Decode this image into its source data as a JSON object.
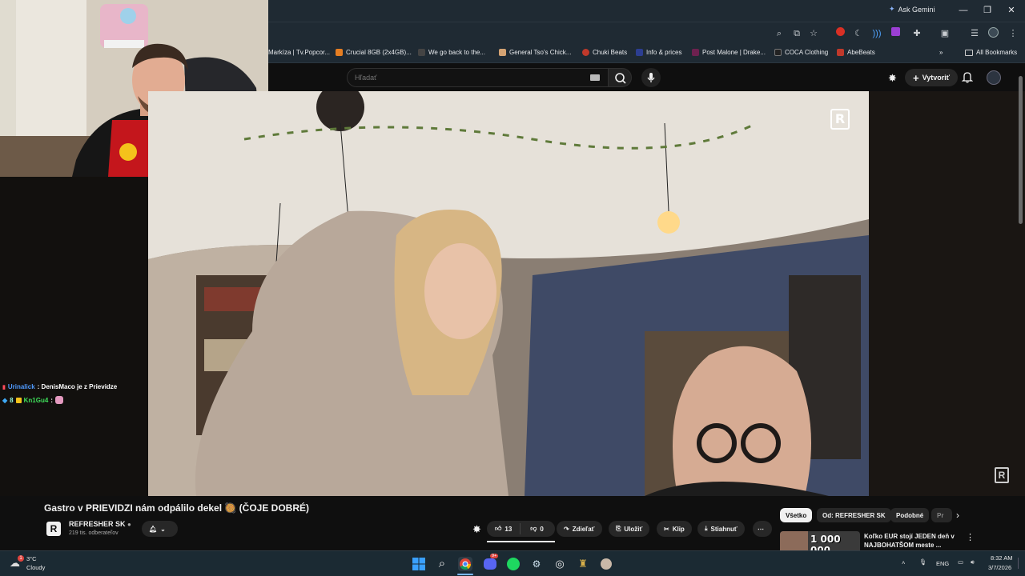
{
  "browser": {
    "ask_gemini": "Ask Gemini",
    "window_controls": {
      "minimize": "—",
      "restore": "❐",
      "close": "✕"
    },
    "bookmarks": [
      {
        "label": "Markíza | Tv.Popcor...",
        "color": "#c0392b"
      },
      {
        "label": "Crucial 8GB (2x4GB)...",
        "color": "#e67e22"
      },
      {
        "label": "We go back to the...",
        "color": "#444444"
      },
      {
        "label": "General Tso's Chick...",
        "color": "#d4a373"
      },
      {
        "label": "Chuki Beats",
        "color": "#c0392b"
      },
      {
        "label": "Info & prices",
        "color": "#2c3e91"
      },
      {
        "label": "Post Malone | Drake...",
        "color": "#6d214f"
      },
      {
        "label": "COCA Clothing",
        "color": "#222222"
      },
      {
        "label": "AbeBeats",
        "color": "#c0392b"
      }
    ],
    "all_bookmarks": "All Bookmarks"
  },
  "youtube": {
    "search_placeholder": "Hľadať",
    "create_label": "Vytvoriť",
    "video_title": "Gastro v PRIEVIDZI nám odpálilo dekel 🥘 (ČOJE DOBRÉ)",
    "channel_name": "REFRESHER SK",
    "subscribers": "219 tis. odberateľov",
    "likes": "13",
    "dislikes": "0",
    "actions": {
      "share": "Zdieľať",
      "save": "Uložiť",
      "clip": "Klip",
      "download": "Stiahnuť"
    },
    "chips": [
      "Všetko",
      "Od: REFRESHER SK",
      "Podobné",
      "Pr"
    ],
    "rec_thumb_text": "1 000 000",
    "rec_title_line1": "Koľko EUR stojí JEDEN deň v",
    "rec_title_line2": "NAJBOHATŠOM meste ..."
  },
  "chat": [
    {
      "user": "Urinalick",
      "user_color": "#4f9bff",
      "message": ": DenisMaco je z Prievidze"
    },
    {
      "user": "Kn1Gu4",
      "user_color": "#3fe05a",
      "message": ":",
      "badge": "8"
    }
  ],
  "taskbar": {
    "weather_temp": "3°C",
    "weather_desc": "Cloudy",
    "weather_badge": "1",
    "lang": "ENG",
    "time": "8:32 AM",
    "date": "3/7/2026",
    "discord_badge": "9+"
  }
}
